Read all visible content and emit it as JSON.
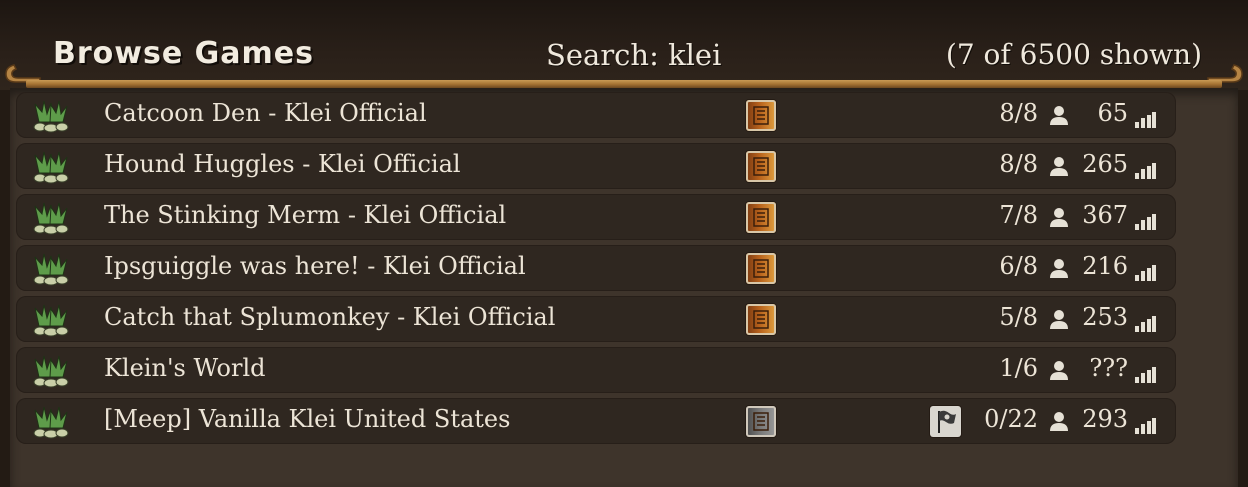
{
  "header": {
    "title": "Browse Games",
    "search": "Search: klei",
    "count": "(7 of 6500 shown)"
  },
  "servers": [
    {
      "name": "Catcoon Den - Klei Official",
      "mode": "survival",
      "flag": false,
      "players": "8/8",
      "ping": "65"
    },
    {
      "name": "Hound Huggles - Klei Official",
      "mode": "survival",
      "flag": false,
      "players": "8/8",
      "ping": "265"
    },
    {
      "name": "The Stinking Merm - Klei Official",
      "mode": "survival",
      "flag": false,
      "players": "7/8",
      "ping": "367"
    },
    {
      "name": "Ipsguiggle was here! - Klei Official",
      "mode": "survival",
      "flag": false,
      "players": "6/8",
      "ping": "216"
    },
    {
      "name": "Catch that Splumonkey - Klei Official",
      "mode": "survival",
      "flag": false,
      "players": "5/8",
      "ping": "253"
    },
    {
      "name": "Klein's World",
      "mode": "none",
      "flag": false,
      "players": "1/6",
      "ping": "???"
    },
    {
      "name": "[Meep] Vanilla Klei United States",
      "mode": "vanilla",
      "flag": true,
      "players": "0/22",
      "ping": "293"
    }
  ],
  "icons": {
    "row_leading": "plant-icon",
    "mode_survival": "survival-mode-icon",
    "mode_vanilla": "vanilla-mode-icon",
    "flag": "pvp-flag-icon",
    "players": "player-icon",
    "ping": "signal-bars-icon"
  },
  "colors": {
    "rail": "#a67434",
    "row_bg": "#2f2720",
    "panel_bg": "#3e342b",
    "text": "#ece4d6"
  }
}
